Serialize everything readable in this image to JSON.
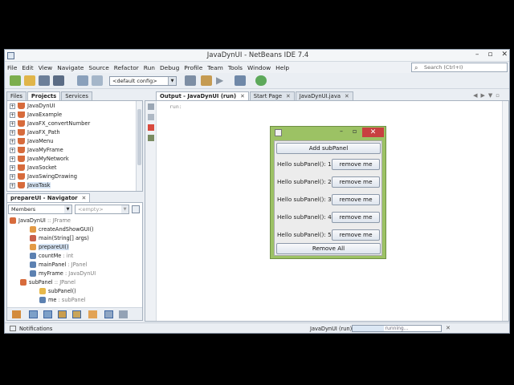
{
  "window": {
    "title": "JavaDynUI - NetBeans IDE 7.4",
    "controls": [
      "–",
      "▫",
      "✕"
    ]
  },
  "menu": [
    "File",
    "Edit",
    "View",
    "Navigate",
    "Source",
    "Refactor",
    "Run",
    "Debug",
    "Profile",
    "Team",
    "Tools",
    "Window",
    "Help"
  ],
  "search": {
    "placeholder": "Search (Ctrl+I)"
  },
  "toolbar": {
    "config": "<default config>"
  },
  "projects": {
    "tabs": [
      "Files",
      "Projects",
      "Services"
    ],
    "items": [
      "JavaDynUI",
      "JavaExample",
      "JavaFX_convertNumber",
      "JavaFX_Path",
      "JavaMenu",
      "JavaMyFrame",
      "JavaMyNetwork",
      "JavaSocket",
      "JavaSwingDrawing",
      "JavaTask"
    ]
  },
  "navigator": {
    "tab": "prepareUI - Navigator",
    "filter": "Members",
    "filter2": "<empty>",
    "rows": [
      {
        "name": "JavaDynUI",
        "type": " :: JFrame"
      },
      {
        "name": "createAndShowGUI()",
        "type": ""
      },
      {
        "name": "main(String[] args)",
        "type": ""
      },
      {
        "name": "prepareUI()",
        "type": ""
      },
      {
        "name": "countMe",
        "type": " : int"
      },
      {
        "name": "mainPanel",
        "type": " : JPanel"
      },
      {
        "name": "myFrame",
        "type": " : JavaDynUI"
      },
      {
        "name": "subPanel",
        "type": " :: JPanel"
      },
      {
        "name": "subPanel()",
        "type": ""
      },
      {
        "name": "me",
        "type": " : subPanel"
      }
    ]
  },
  "editor": {
    "tabs": [
      "Output - JavaDynUI (run)",
      "Start Page",
      "JavaDynUI.java"
    ],
    "output_line": "run:"
  },
  "status": {
    "notifications": "Notifications",
    "task": "JavaDynUI (run)",
    "progress_text": "running...",
    "progress": 0.35
  },
  "app": {
    "add_button": "Add subPanel",
    "panels": [
      {
        "label": "Hello subPanel(): 1",
        "button": "remove me"
      },
      {
        "label": "Hello subPanel(): 2",
        "button": "remove me"
      },
      {
        "label": "Hello subPanel(): 3",
        "button": "remove me"
      },
      {
        "label": "Hello subPanel(): 4",
        "button": "remove me"
      },
      {
        "label": "Hello subPanel(): 5",
        "button": "remove me"
      }
    ],
    "remove_all": "Remove All"
  }
}
